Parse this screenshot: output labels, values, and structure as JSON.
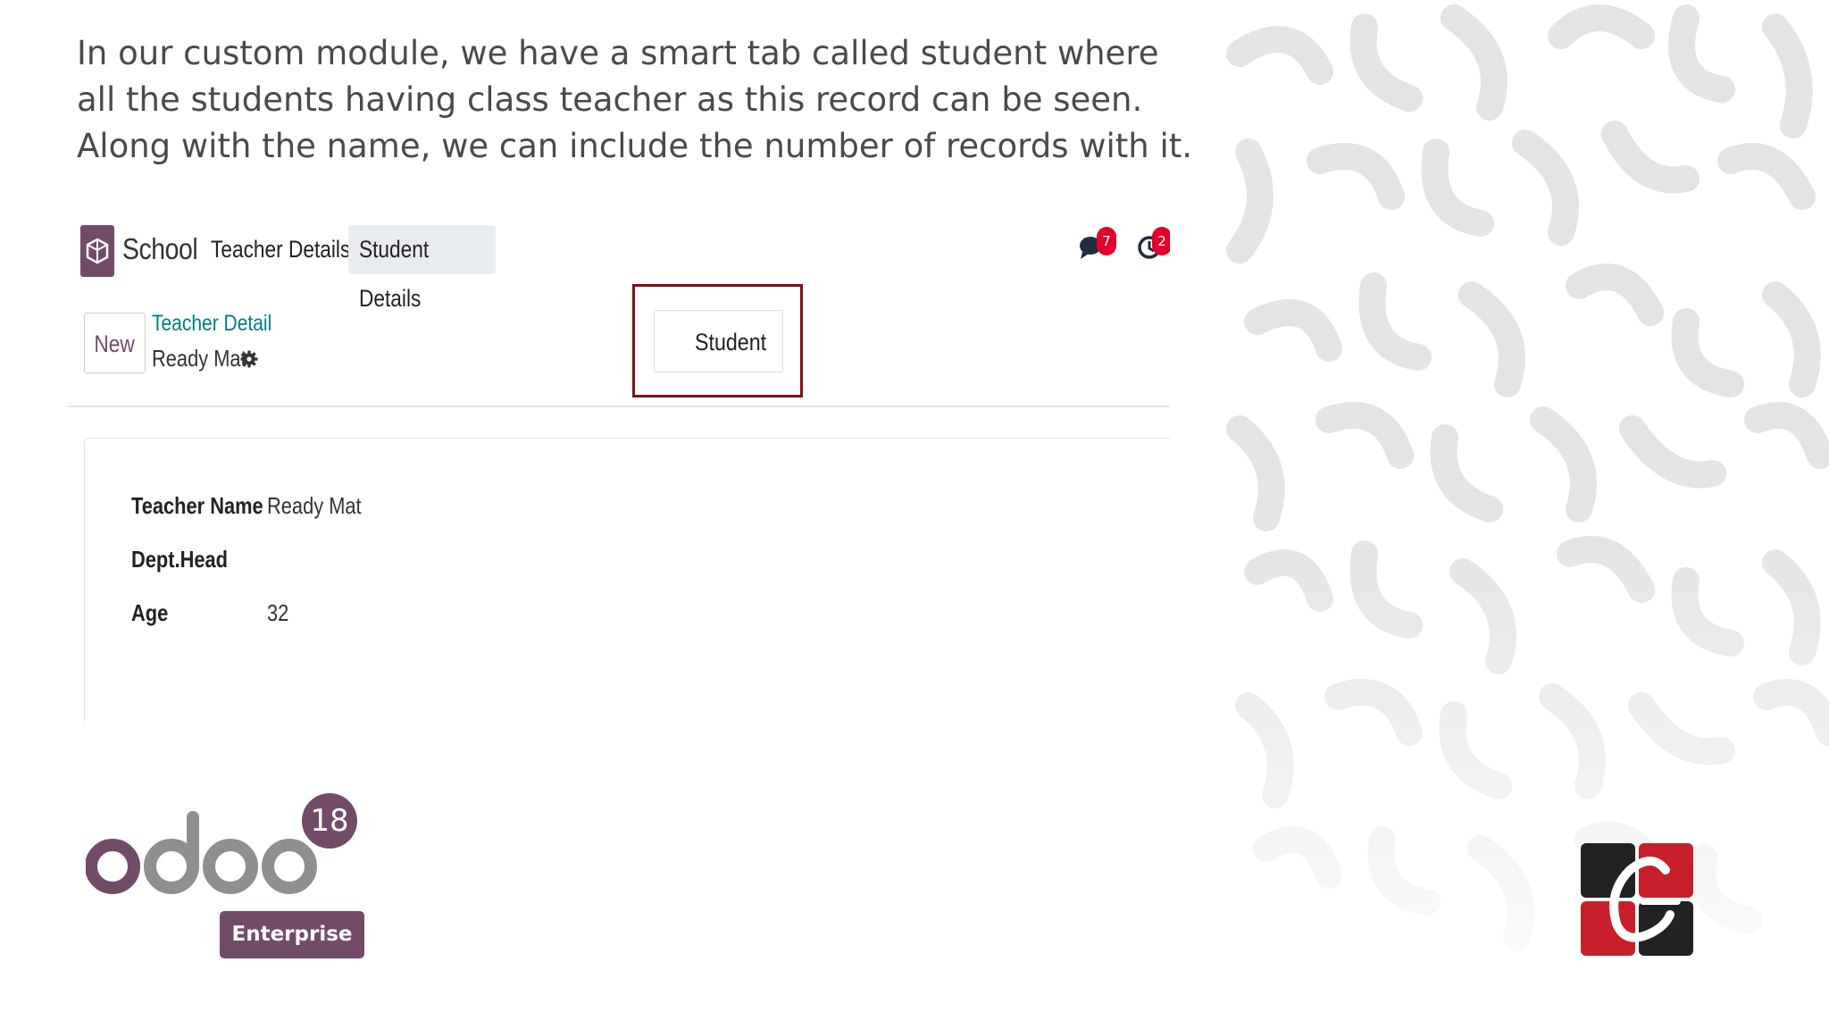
{
  "caption": {
    "line1": "In our custom module, we have a smart tab called student where",
    "line2": "all the students having class teacher as this record can be seen.",
    "line3": "Along with the name, we can include the number of records with it."
  },
  "navbar": {
    "app_name": "School",
    "menus": [
      "Teacher Details",
      "Student Details"
    ],
    "active_menu": "Student Details",
    "messages_badge": "7",
    "activities_badge": "2"
  },
  "control_panel": {
    "new_label": "New",
    "breadcrumb": "Teacher Detail",
    "record_name": "Ready Mat",
    "smart_button_label": "Student"
  },
  "form": {
    "fields": [
      {
        "label": "Teacher Name",
        "value": "Ready Mat"
      },
      {
        "label": "Dept.Head",
        "value": ""
      },
      {
        "label": "Age",
        "value": "32"
      }
    ]
  },
  "branding": {
    "version": "18",
    "edition": "Enterprise"
  },
  "colors": {
    "odoo_purple": "#714b67",
    "odoo_gray": "#8f8f8f",
    "link_teal": "#017e84",
    "badge_red": "#e3002b",
    "highlight_border": "#7a1414"
  }
}
